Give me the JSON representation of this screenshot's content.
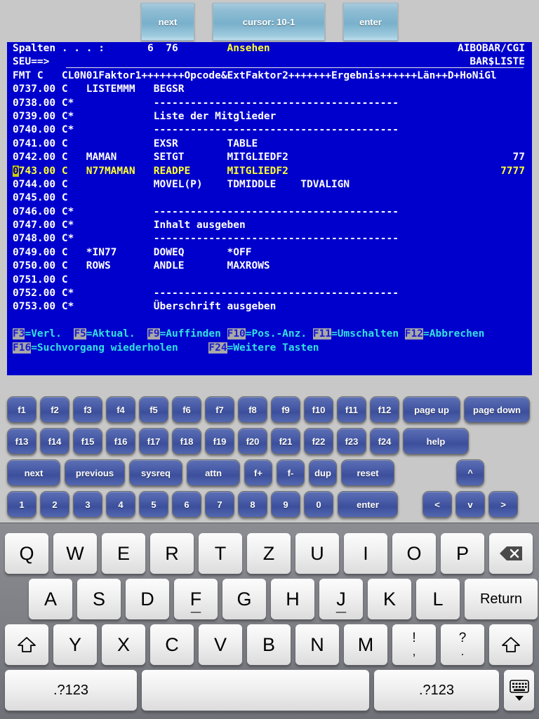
{
  "toolbar": {
    "next_label": "next",
    "cursor_label": "cursor: 10-1",
    "enter_label": "enter"
  },
  "terminal": {
    "colors": {
      "background": "#0000cc",
      "text": "#ffffff",
      "highlight": "#ffff33",
      "fkey_text": "#33e0e0",
      "fkey_tag_bg": "#a8a8a8",
      "cursor_bg": "#cccc00"
    },
    "header": {
      "columns_label": "Spalten . . . :",
      "columns_from": "6",
      "columns_to": "76",
      "mode": "Ansehen",
      "library": "AIBOBAR/CGI",
      "prompt_label": "SEU==>",
      "prompt_value": "",
      "member": "BAR$LISTE",
      "format_label": "FMT C",
      "format_ruler": "CL0N01Faktor1+++++++Opcode&ExtFaktor2+++++++Ergebnis++++++Län++D+HoNiGl"
    },
    "lines": [
      {
        "num": "0737.00",
        "spec": "C",
        "factor1": "LISTEMMM",
        "opcode": "BEGSR",
        "factor2": "",
        "result": "",
        "len": "",
        "cursor": false
      },
      {
        "num": "0738.00",
        "spec": "C*",
        "factor1": "",
        "opcode": "----------------------------------------",
        "factor2": "",
        "result": "",
        "len": "",
        "cursor": false,
        "comment": true
      },
      {
        "num": "0739.00",
        "spec": "C*",
        "factor1": "",
        "opcode": "Liste der Mitglieder",
        "factor2": "",
        "result": "",
        "len": "",
        "cursor": false,
        "comment": true
      },
      {
        "num": "0740.00",
        "spec": "C*",
        "factor1": "",
        "opcode": "----------------------------------------",
        "factor2": "",
        "result": "",
        "len": "",
        "cursor": false,
        "comment": true
      },
      {
        "num": "0741.00",
        "spec": "C",
        "factor1": "",
        "opcode": "EXSR",
        "factor2": "TABLE",
        "result": "",
        "len": "",
        "cursor": false
      },
      {
        "num": "0742.00",
        "spec": "C",
        "factor1": "MAMAN",
        "opcode": "SETGT",
        "factor2": "MITGLIEDF2",
        "result": "",
        "len": "77",
        "cursor": false
      },
      {
        "num": "0743.00",
        "spec": "C",
        "factor1": "N77MAMAN",
        "opcode": "READPE",
        "factor2": "MITGLIEDF2",
        "result": "",
        "len": "7777",
        "cursor": true
      },
      {
        "num": "0744.00",
        "spec": "C",
        "factor1": "",
        "opcode": "MOVEL(P)",
        "factor2": "TDMIDDLE",
        "result": "TDVALIGN",
        "len": "",
        "cursor": false
      },
      {
        "num": "0745.00",
        "spec": "C",
        "factor1": "",
        "opcode": "",
        "factor2": "",
        "result": "",
        "len": "",
        "cursor": false
      },
      {
        "num": "0746.00",
        "spec": "C*",
        "factor1": "",
        "opcode": "----------------------------------------",
        "factor2": "",
        "result": "",
        "len": "",
        "cursor": false,
        "comment": true
      },
      {
        "num": "0747.00",
        "spec": "C*",
        "factor1": "",
        "opcode": "Inhalt ausgeben",
        "factor2": "",
        "result": "",
        "len": "",
        "cursor": false,
        "comment": true
      },
      {
        "num": "0748.00",
        "spec": "C*",
        "factor1": "",
        "opcode": "----------------------------------------",
        "factor2": "",
        "result": "",
        "len": "",
        "cursor": false,
        "comment": true
      },
      {
        "num": "0749.00",
        "spec": "C",
        "factor1": "*IN77",
        "opcode": "DOWEQ",
        "factor2": "*OFF",
        "result": "",
        "len": "",
        "cursor": false
      },
      {
        "num": "0750.00",
        "spec": "C",
        "factor1": "ROWS",
        "opcode": "ANDLE",
        "factor2": "MAXROWS",
        "result": "",
        "len": "",
        "cursor": false
      },
      {
        "num": "0751.00",
        "spec": "C",
        "factor1": "",
        "opcode": "",
        "factor2": "",
        "result": "",
        "len": "",
        "cursor": false
      },
      {
        "num": "0752.00",
        "spec": "C*",
        "factor1": "",
        "opcode": "----------------------------------------",
        "factor2": "",
        "result": "",
        "len": "",
        "cursor": false,
        "comment": true
      },
      {
        "num": "0753.00",
        "spec": "C*",
        "factor1": "",
        "opcode": "Überschrift ausgeben",
        "factor2": "",
        "result": "",
        "len": "",
        "cursor": false,
        "comment": true
      }
    ],
    "fkeys_row1": [
      {
        "key": "F3",
        "desc": "=Verl."
      },
      {
        "key": "F5",
        "desc": "=Aktual."
      },
      {
        "key": "F9",
        "desc": "=Auffinden"
      },
      {
        "key": "F10",
        "desc": "=Pos.-Anz."
      },
      {
        "key": "F11",
        "desc": "=Umschalten"
      },
      {
        "key": "F12",
        "desc": "=Abbrechen"
      }
    ],
    "fkeys_row2": [
      {
        "key": "F16",
        "desc": "=Suchvorgang wiederholen"
      },
      {
        "key": "F24",
        "desc": "=Weitere Tasten"
      }
    ]
  },
  "keypad": {
    "row1": [
      "f1",
      "f2",
      "f3",
      "f4",
      "f5",
      "f6",
      "f7",
      "f8",
      "f9",
      "f10",
      "f11",
      "f12",
      "page up",
      "page down"
    ],
    "row2": [
      "f13",
      "f14",
      "f15",
      "f16",
      "f17",
      "f18",
      "f19",
      "f20",
      "f21",
      "f22",
      "f23",
      "f24",
      "help"
    ],
    "row3": [
      "next",
      "previous",
      "sysreq",
      "attn",
      "f+",
      "f-",
      "dup",
      "reset",
      "^"
    ],
    "row4": [
      "1",
      "2",
      "3",
      "4",
      "5",
      "6",
      "7",
      "8",
      "9",
      "0",
      "enter",
      "<",
      "v",
      ">"
    ]
  },
  "ioskeyboard": {
    "row1": [
      "Q",
      "W",
      "E",
      "R",
      "T",
      "Z",
      "U",
      "I",
      "O",
      "P"
    ],
    "backspace_icon": "backspace-icon",
    "row2": [
      "A",
      "S",
      "D",
      "F",
      "G",
      "H",
      "J",
      "K",
      "L"
    ],
    "return_label": "Return",
    "row3": [
      "Y",
      "X",
      "C",
      "V",
      "B",
      "N",
      "M"
    ],
    "shift_icon": "shift-arrow-icon",
    "punct1_top": "!",
    "punct1_bottom": ",",
    "punct2_top": "?",
    "punct2_bottom": ".",
    "numeric_label": ".?123",
    "space_label": "",
    "hide_keyboard_icon": "hide-keyboard-icon"
  }
}
